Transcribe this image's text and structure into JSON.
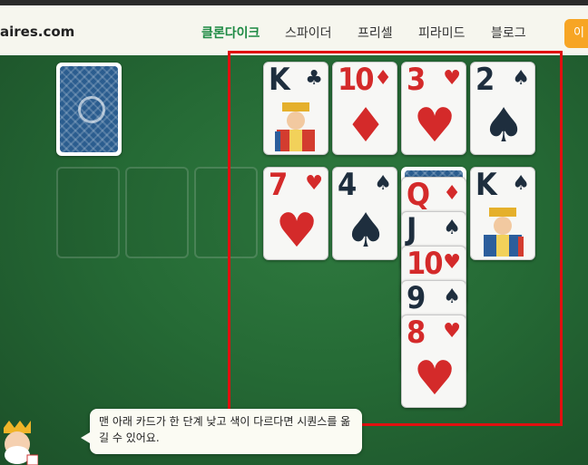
{
  "site": {
    "logo_text": "aires.com"
  },
  "nav": {
    "links": [
      "클론다이크",
      "스파이더",
      "프리셀",
      "피라미드",
      "블로그"
    ],
    "active": "클론다이크",
    "cta_label": "이"
  },
  "foundation": [
    {
      "rank": "K",
      "suit": "♣",
      "color": "black"
    },
    {
      "rank": "10",
      "suit": "♦",
      "color": "red"
    },
    {
      "rank": "3",
      "suit": "♥",
      "color": "red"
    },
    {
      "rank": "2",
      "suit": "♠",
      "color": "black"
    }
  ],
  "tableau_row": [
    {
      "rank": "7",
      "suit": "♥",
      "color": "red"
    },
    {
      "rank": "4",
      "suit": "♠",
      "color": "black"
    }
  ],
  "stack": [
    {
      "rank": "Q",
      "suit": "♦",
      "color": "red"
    },
    {
      "rank": "J",
      "suit": "♠",
      "color": "black"
    },
    {
      "rank": "10",
      "suit": "♥",
      "color": "red"
    },
    {
      "rank": "9",
      "suit": "♠",
      "color": "black"
    },
    {
      "rank": "8",
      "suit": "♥",
      "color": "red"
    }
  ],
  "last_column": {
    "rank": "K",
    "suit": "♠",
    "color": "black"
  },
  "hint": {
    "text": "맨 아래 카드가 한 단계 낮고 색이 다르다면 시퀀스를 옮길 수 있어요."
  },
  "colors": {
    "red_suit": "#d42a2a",
    "black_suit": "#1e2e3e",
    "highlight": "#e01010",
    "felt": "#256a35",
    "accent": "#1e8a44"
  }
}
